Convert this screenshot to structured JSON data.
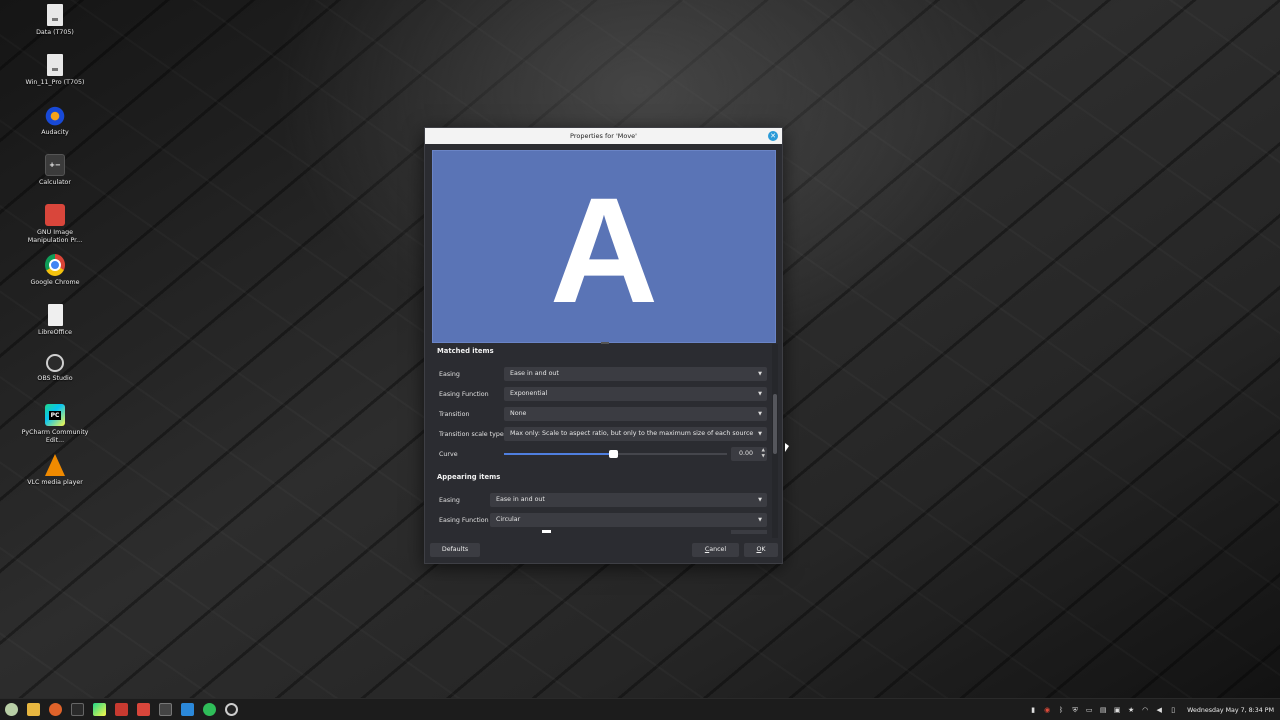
{
  "desktop": {
    "icons": [
      {
        "label": "Data (T705)",
        "icon": "drive-icon"
      },
      {
        "label": "Win_11_Pro (T705)",
        "icon": "drive-icon"
      },
      {
        "label": "Audacity",
        "icon": "audacity-icon"
      },
      {
        "label": "Calculator",
        "icon": "calculator-icon"
      },
      {
        "label": "GNU Image Manipulation Pr...",
        "icon": "gimp-icon"
      },
      {
        "label": "Google Chrome",
        "icon": "chrome-icon"
      },
      {
        "label": "LibreOffice",
        "icon": "libreoffice-icon"
      },
      {
        "label": "OBS Studio",
        "icon": "obs-icon"
      },
      {
        "label": "PyCharm Community Edit...",
        "icon": "pycharm-icon"
      },
      {
        "label": "VLC media player",
        "icon": "vlc-icon"
      }
    ]
  },
  "dialog": {
    "title": "Properties for 'Move'",
    "preview_letter": "A",
    "preview_color": "#5a74b6",
    "matched": {
      "title": "Matched items",
      "easing_label": "Easing",
      "easing_value": "Ease in and out",
      "easing_function_label": "Easing Function",
      "easing_function_value": "Exponential",
      "transition_label": "Transition",
      "transition_value": "None",
      "scale_type_label": "Transition scale type",
      "scale_type_value": "Max only: Scale to aspect ratio, but only to the maximum size of each source",
      "curve_label": "Curve",
      "curve_value": "0.00",
      "curve_slider_fraction": 0.49
    },
    "appearing": {
      "title": "Appearing items",
      "easing_label": "Easing",
      "easing_value": "Ease in and out",
      "easing_function_label": "Easing Function",
      "easing_function_value": "Circular"
    },
    "buttons": {
      "defaults": "Defaults",
      "cancel_mnemonic": "C",
      "cancel_rest": "ancel",
      "ok_mnemonic": "O",
      "ok_rest": "K"
    }
  },
  "taskbar": {
    "clock": "Wednesday May 7, 8:34 PM",
    "accent": "#4f7fe0"
  }
}
